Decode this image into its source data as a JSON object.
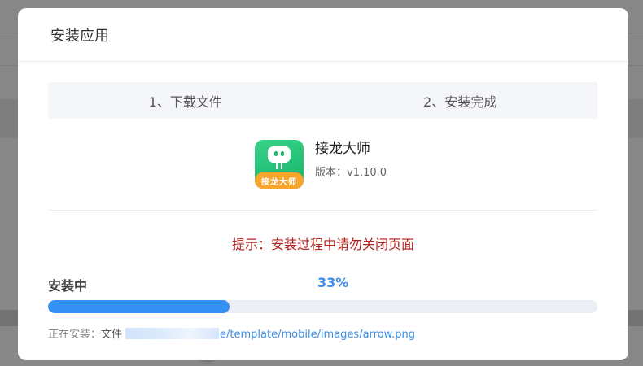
{
  "dialog": {
    "title": "安装应用"
  },
  "steps": [
    {
      "label": "1、下载文件"
    },
    {
      "label": "2、安装完成"
    }
  ],
  "app": {
    "name": "接龙大师",
    "version": "版本：v1.10.0",
    "icon_banner": "接龙大师",
    "icon": "robot-face-icon"
  },
  "tip": "提示：安装过程中请勿关闭页面",
  "progress": {
    "label": "安装中",
    "percent_text": "33%",
    "value": 0.33
  },
  "install": {
    "prefix": "正在安装：",
    "file_label": "文件",
    "path": "e/template/mobile/images/arrow.png"
  },
  "colors": {
    "accent": "#3590f3",
    "warning_text": "#b1211e",
    "app_icon_green": "#14b46a",
    "app_icon_orange": "#f7a52b"
  }
}
